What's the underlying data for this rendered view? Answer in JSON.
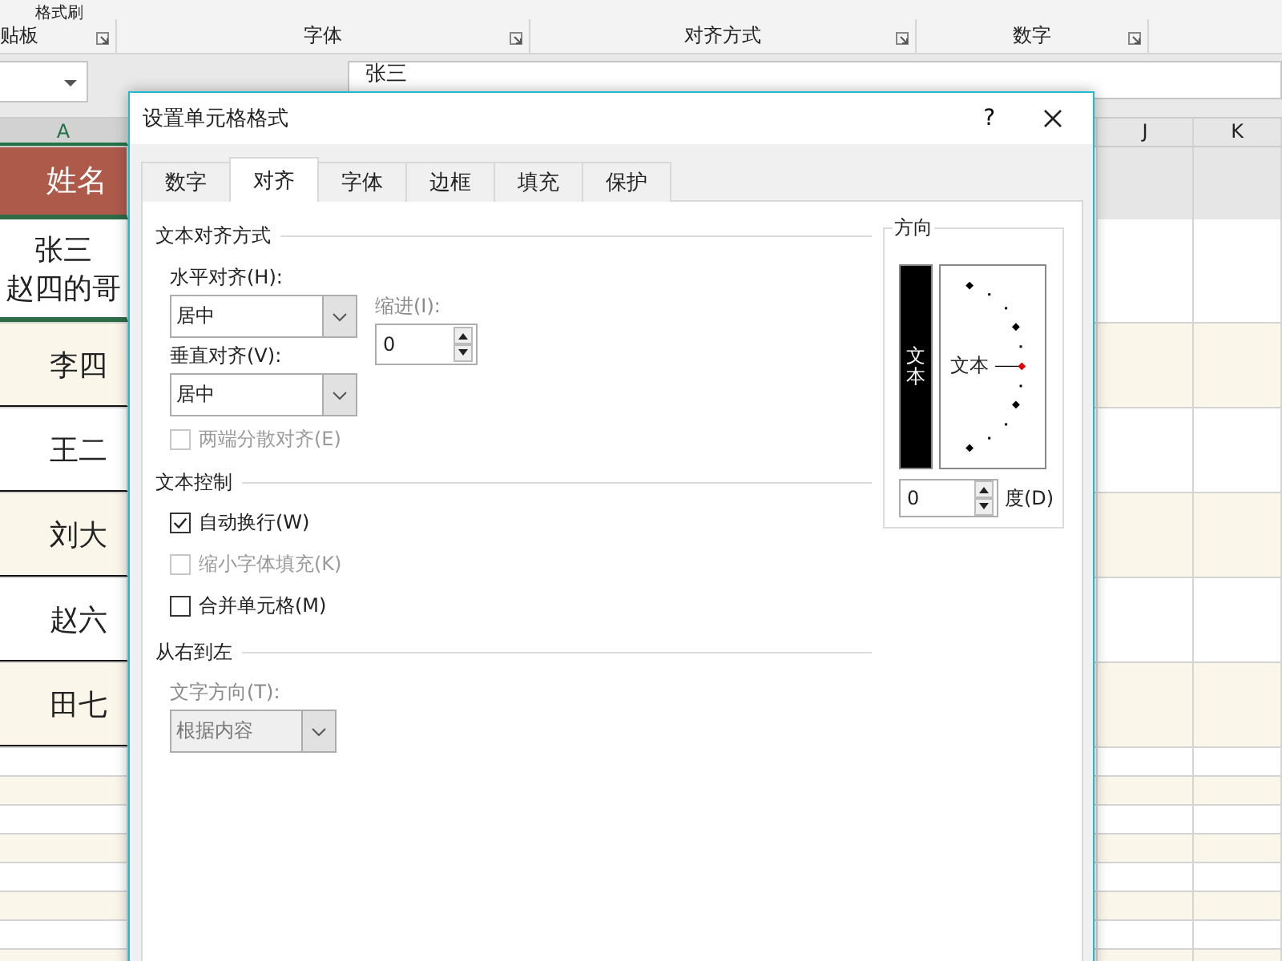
{
  "ribbon": {
    "clipboard_button": "格式刷",
    "groups": [
      {
        "label": "贴板"
      },
      {
        "label": "字体"
      },
      {
        "label": "对齐方式"
      },
      {
        "label": "数字"
      }
    ]
  },
  "formula_bar": {
    "value": "张三"
  },
  "sheet": {
    "columns": [
      "A",
      "J",
      "K"
    ],
    "header": "姓名",
    "rows": [
      {
        "lines": [
          "张三",
          "赵四的哥"
        ]
      },
      {
        "lines": [
          "李四"
        ]
      },
      {
        "lines": [
          "王二"
        ]
      },
      {
        "lines": [
          "刘大"
        ]
      },
      {
        "lines": [
          "赵六"
        ]
      },
      {
        "lines": [
          "田七"
        ]
      }
    ]
  },
  "dialog": {
    "title": "设置单元格格式",
    "help": "?",
    "tabs": [
      {
        "label": "数字",
        "selected": false
      },
      {
        "label": "对齐",
        "selected": true
      },
      {
        "label": "字体",
        "selected": false
      },
      {
        "label": "边框",
        "selected": false
      },
      {
        "label": "填充",
        "selected": false
      },
      {
        "label": "保护",
        "selected": false
      }
    ],
    "text_alignment": {
      "title": "文本对齐方式",
      "horizontal_label": "水平对齐(H):",
      "horizontal_value": "居中",
      "vertical_label": "垂直对齐(V):",
      "vertical_value": "居中",
      "indent_label": "缩进(I):",
      "indent_value": "0",
      "options": [
        {
          "label": "两端分散对齐(E)",
          "checked": false,
          "disabled": true
        }
      ]
    },
    "text_control": {
      "title": "文本控制",
      "options": [
        {
          "label": "自动换行(W)",
          "checked": true,
          "disabled": false
        },
        {
          "label": "缩小字体填充(K)",
          "checked": false,
          "disabled": true
        },
        {
          "label": "合并单元格(M)",
          "checked": false,
          "disabled": false
        }
      ]
    },
    "right_to_left": {
      "title": "从右到左",
      "direction_label": "文字方向(T):",
      "direction_value": "根据内容",
      "disabled": true
    },
    "orientation": {
      "title": "方向",
      "vertical_text": "文本",
      "dial_text": "文本",
      "degrees": "0",
      "degrees_label": "度(D)"
    }
  }
}
